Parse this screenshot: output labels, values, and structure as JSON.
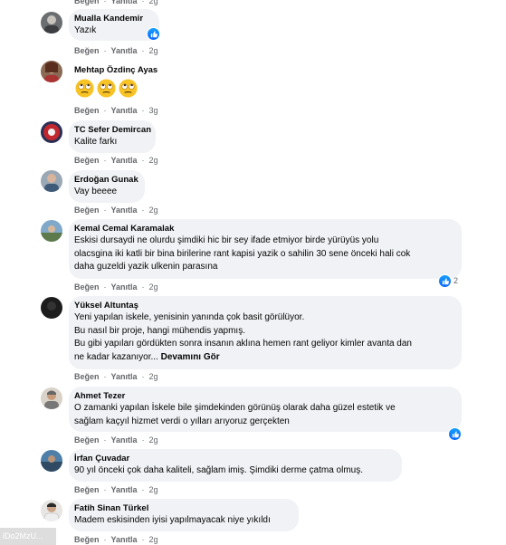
{
  "actions": {
    "like": "Beğen",
    "reply": "Yanıtla",
    "separator": "·"
  },
  "top_row": {
    "time": "2g"
  },
  "comments": [
    {
      "author": "Mualla Kandemir",
      "text": [
        "Yazık"
      ],
      "time": "2g",
      "reactions": ""
    },
    {
      "author": "Mehtap Özdinç Ayas",
      "text": [],
      "emojis": [
        "rolling-eyes",
        "rolling-eyes",
        "rolling-eyes"
      ],
      "time": "3g"
    },
    {
      "author": "TC Sefer Demircan",
      "text": [
        "Kalite farkı"
      ],
      "time": "2g"
    },
    {
      "author": "Erdoğan Gunak",
      "text": [
        "Vay beeee"
      ],
      "time": "2g"
    },
    {
      "author": "Kemal Cemal Karamalak",
      "text": [
        "Eskisi dursaydi ne olurdu şimdiki hic bir sey ifade etmiyor birde yürüyüs yolu",
        "olacsgina iki katli bir bina birilerine rant kapisi yazik o sahilin 30 sene önceki hali cok",
        "daha guzeldi yazik ulkenin parasına"
      ],
      "time": "2g",
      "reactions": "2"
    },
    {
      "author": "Yüksel Altuntaş",
      "text": [
        "Yeni yapılan iskele, yenisinin yanında çok basit görülüyor.",
        "Bu nasıl bir proje, hangi mühendis yapmış.",
        "Bu gibi yapıları gördükten sonra insanın aklına hemen rant geliyor kimler avanta dan",
        "ne kadar kazanıyor..."
      ],
      "see_more": "Devamını Gör",
      "time": "2g"
    },
    {
      "author": "Ahmet Tezer",
      "text": [
        "O zamanki yapılan İskele bile şimdekinden görünüş olarak daha güzel estetik ve",
        "sağlam kaçyıl hizmet verdi o yılları arıyoruz gerçekten"
      ],
      "time": "2g",
      "reactions": ""
    },
    {
      "author": "İrfan Çuvadar",
      "text": [
        "90 yıl önceki çok daha kaliteli, sağlam imiş. Şimdiki derme çatma olmuş."
      ],
      "time": "2g"
    },
    {
      "author": "Fatih Sinan Türkel",
      "text": [
        "Madem eskisinden iyisi yapılmayacak niye yıkıldı"
      ],
      "time": "2g"
    }
  ],
  "watermark": "lDo2MzU..."
}
